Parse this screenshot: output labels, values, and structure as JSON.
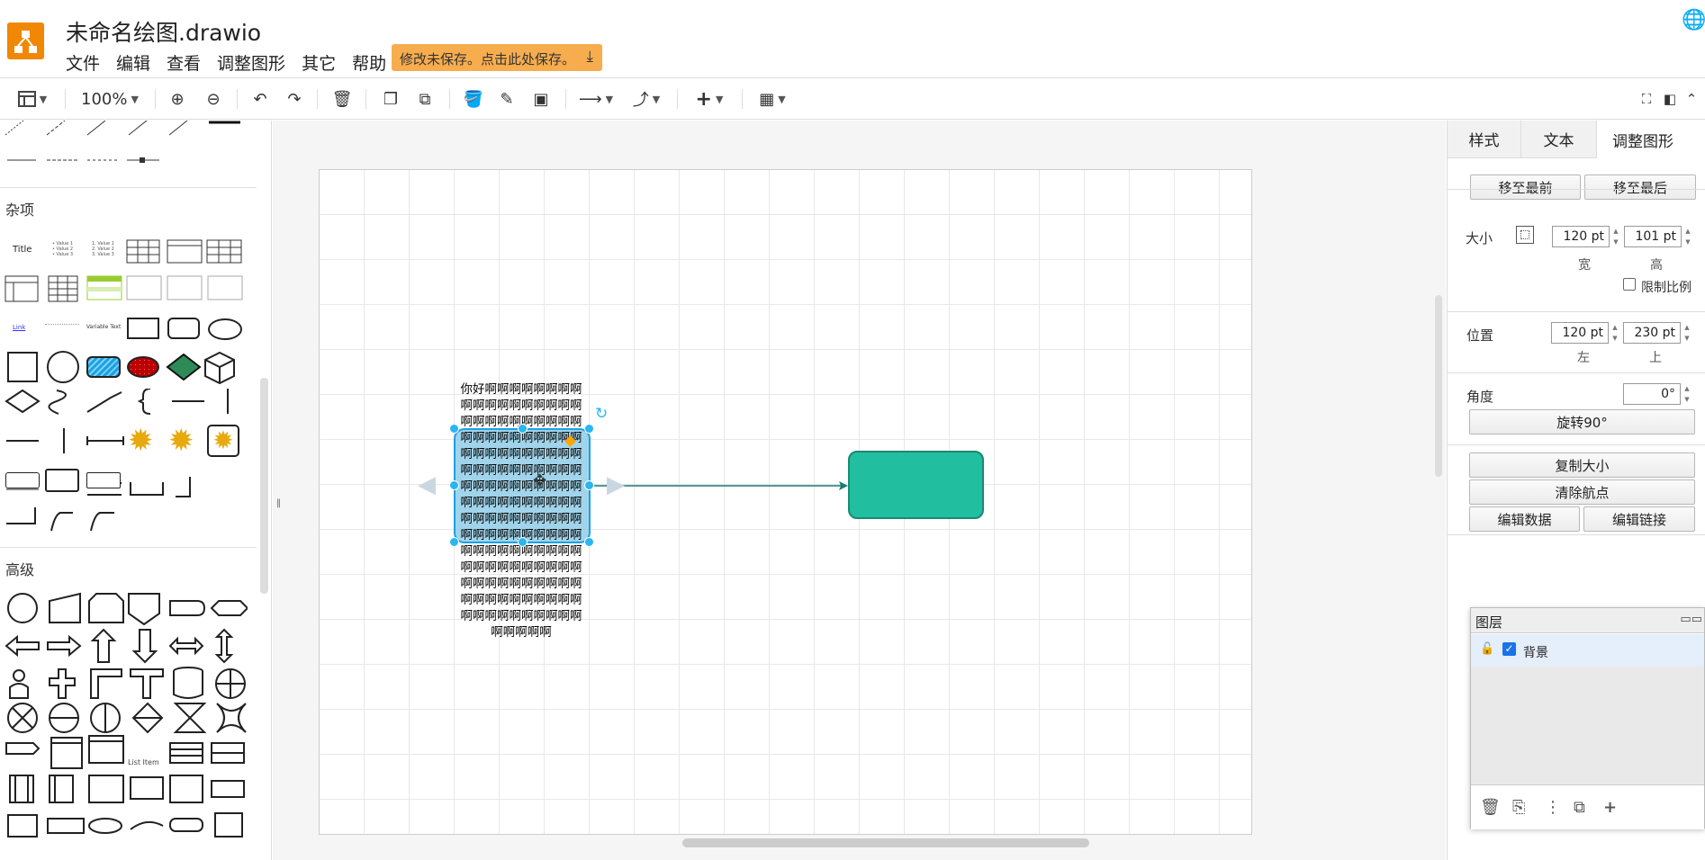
{
  "app": {
    "title": "未命名绘图.drawio",
    "save_notice": "修改未保存。点击此处保存。",
    "menu": [
      "文件",
      "编辑",
      "查看",
      "调整图形",
      "其它",
      "帮助"
    ]
  },
  "toolbar": {
    "zoom": "100%"
  },
  "sidebar": {
    "sections": {
      "misc": "杂项",
      "advanced": "高级"
    },
    "misc_shape_labels": {
      "title": "Title",
      "link": "Link",
      "variable_text": "Variable Text",
      "list_item": "List Item"
    }
  },
  "canvas": {
    "selected_shape_text": "你好啊啊啊啊啊啊啊啊啊啊啊啊啊啊啊啊啊啊啊啊啊啊啊啊啊啊啊啊啊啊啊啊啊啊啊啊啊啊啊啊啊啊啊啊啊啊啊啊啊啊啊啊啊啊啊啊啊啊啊啊啊啊啊啊啊啊啊啊啊啊啊啊啊啊啊啊啊啊啊啊啊啊啊啊啊啊啊啊啊啊啊啊啊啊啊啊啊啊啊啊啊啊啊啊啊啊啊啊啊啊啊啊啊啊啊啊啊啊啊啊啊啊啊啊啊啊啊啊啊啊啊啊啊啊啊啊啊啊啊啊啊啊啊啊啊啊啊啊啊啊啊啊啊",
    "selected_fill": "#81c5e3",
    "second_shape_fill": "#21bf9f",
    "edge_color": "#1a7a74"
  },
  "format_panel": {
    "tabs": [
      "样式",
      "文本",
      "调整图形"
    ],
    "active_tab": "调整图形",
    "to_front": "移至最前",
    "to_back": "移至最后",
    "size_label": "大小",
    "width_value": "120 pt",
    "height_value": "101 pt",
    "width_label": "宽",
    "height_label": "高",
    "constrain_label": "限制比例",
    "position_label": "位置",
    "left_value": "120 pt",
    "top_value": "230 pt",
    "left_label": "左",
    "top_label": "上",
    "angle_label": "角度",
    "angle_value": "0°",
    "rotate_btn": "旋转90°",
    "copy_size": "复制大小",
    "clear_waypoints": "清除航点",
    "edit_data": "编辑数据",
    "edit_link": "编辑链接"
  },
  "layers": {
    "title": "图层",
    "items": [
      {
        "name": "背景",
        "visible": true
      }
    ]
  }
}
